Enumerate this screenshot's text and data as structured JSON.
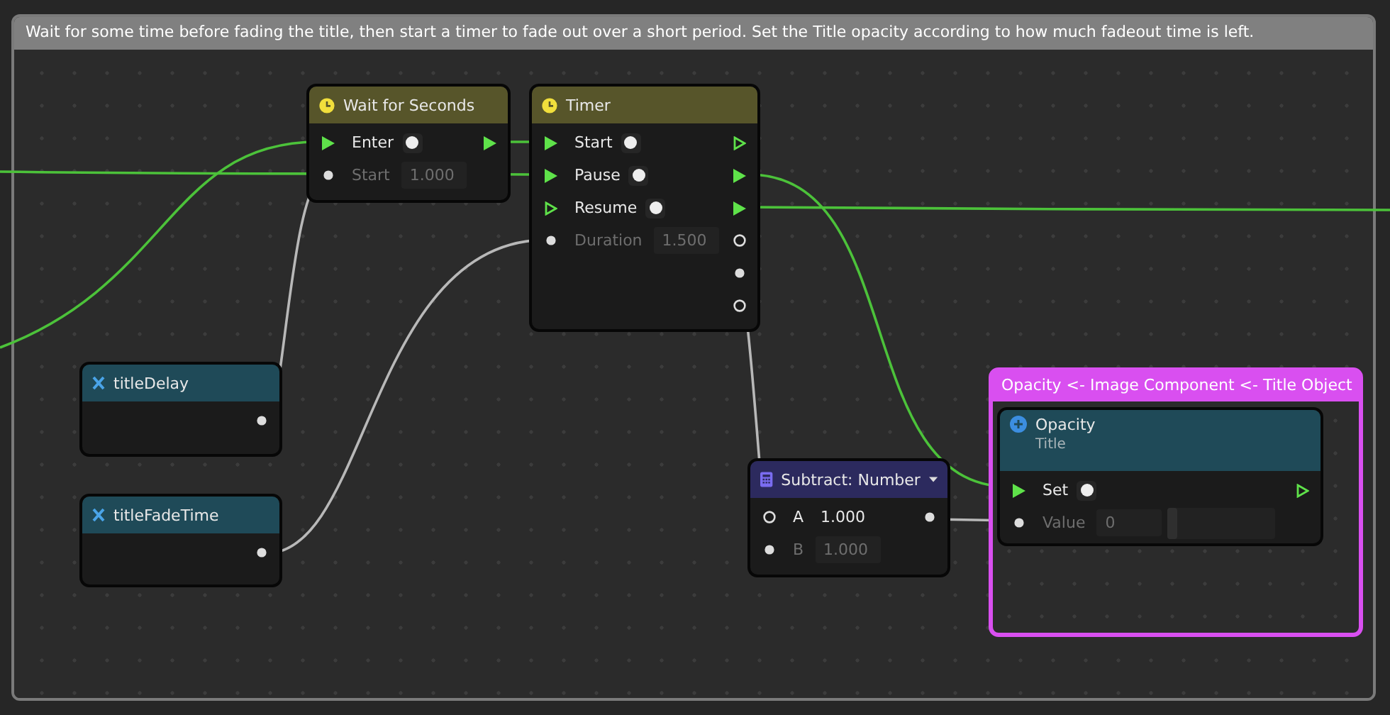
{
  "comment_group": {
    "title": "Wait for some time before fading the title, then start a timer to fade out over a short period. Set the Title opacity according to how much fadeout time is left."
  },
  "nodes": [
    {
      "kind": "event",
      "title": "Wait for Seconds",
      "rows": [
        {
          "in": {
            "kind": "flow",
            "filled": true
          },
          "label": "Enter",
          "toggle": true,
          "out": {
            "kind": "flow",
            "filled": true
          }
        },
        {
          "in": {
            "kind": "data",
            "filled": true
          },
          "label": "Start",
          "disabled": true,
          "value": "1.000"
        }
      ]
    },
    {
      "kind": "event",
      "title": "Timer",
      "rows": [
        {
          "in": {
            "kind": "flow",
            "filled": true
          },
          "label": "Start",
          "toggle": true,
          "out": {
            "kind": "flow",
            "filled": false
          }
        },
        {
          "in": {
            "kind": "flow",
            "filled": true
          },
          "label": "Pause",
          "toggle": true,
          "out": {
            "kind": "flow",
            "filled": true
          }
        },
        {
          "in": {
            "kind": "flow",
            "filled": false
          },
          "label": "Resume",
          "toggle": true,
          "out": {
            "kind": "flow",
            "filled": true
          }
        },
        {
          "in": {
            "kind": "data",
            "filled": true
          },
          "label": "Duration",
          "disabled": true,
          "value": "1.500",
          "out": {
            "kind": "data",
            "filled": false
          }
        },
        {
          "out": {
            "kind": "data",
            "filled": true
          }
        },
        {
          "out": {
            "kind": "data",
            "filled": false
          }
        }
      ]
    },
    {
      "kind": "variable",
      "title": "titleDelay",
      "rows": [
        {
          "out": {
            "kind": "data",
            "filled": true
          }
        }
      ]
    },
    {
      "kind": "variable",
      "title": "titleFadeTime",
      "rows": [
        {
          "out": {
            "kind": "data",
            "filled": true
          }
        }
      ]
    },
    {
      "kind": "math",
      "title": "Subtract: Number",
      "dropdown": true,
      "rows": [
        {
          "in": {
            "kind": "data",
            "filled": false
          },
          "label": "A",
          "disabled": false,
          "plain_value": "1.000",
          "out": {
            "kind": "data",
            "filled": true
          }
        },
        {
          "in": {
            "kind": "data",
            "filled": true
          },
          "label": "B",
          "disabled": true,
          "value": "1.000"
        }
      ]
    }
  ],
  "property_group": {
    "title": "Opacity <- Image Component <- Title Object",
    "node": {
      "kind": "property",
      "title": "Opacity",
      "subtitle": "Title",
      "rows": [
        {
          "in": {
            "kind": "flow",
            "filled": true
          },
          "label": "Set",
          "toggle": true,
          "out": {
            "kind": "flow",
            "filled": false
          }
        },
        {
          "in": {
            "kind": "data",
            "filled": true
          },
          "label": "Value",
          "disabled": true,
          "value": "0",
          "level": 0
        }
      ]
    }
  }
}
